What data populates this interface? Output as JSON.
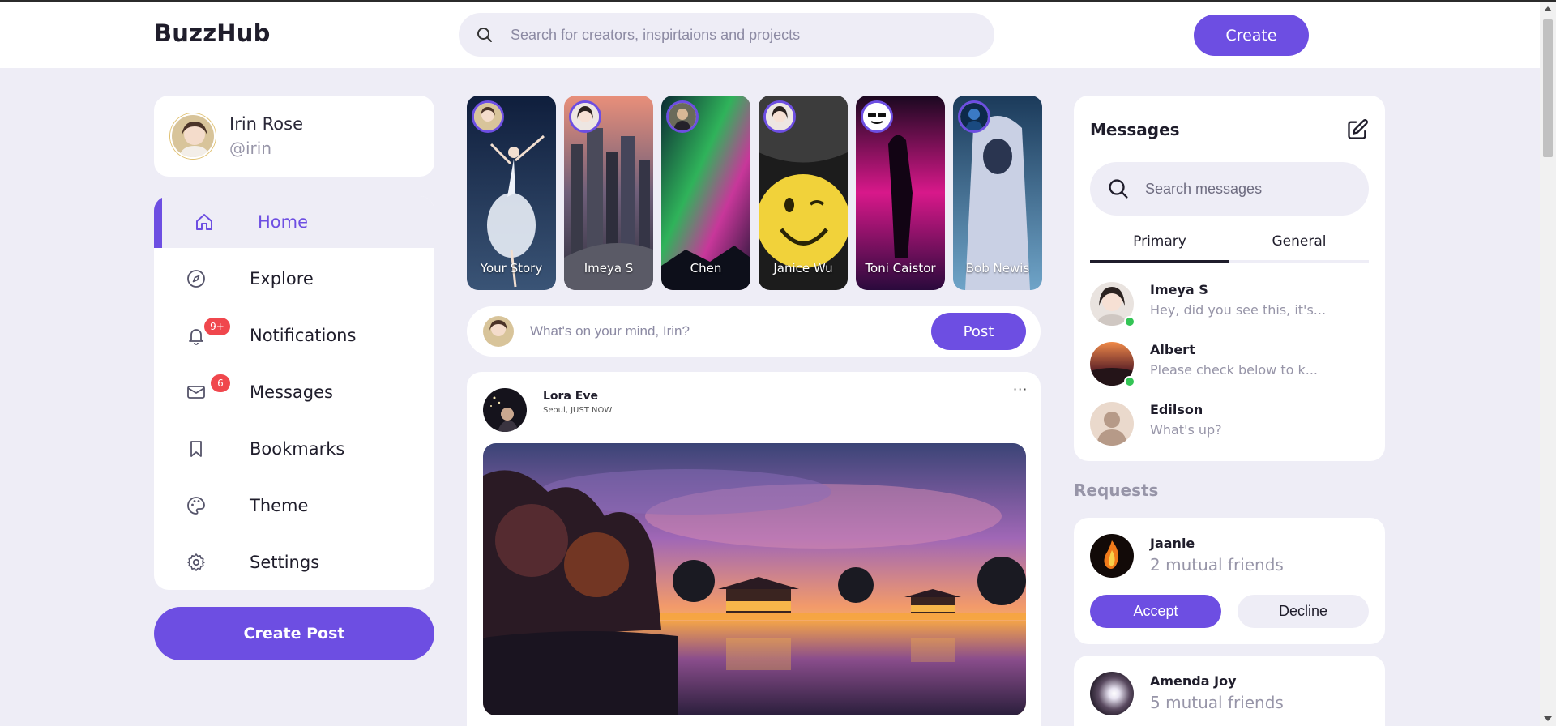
{
  "app": {
    "name": "BuzzHub"
  },
  "header": {
    "search_placeholder": "Search for creators, inspirtaions and projects",
    "create_label": "Create"
  },
  "profile": {
    "name": "Irin Rose",
    "handle": "@irin"
  },
  "sidebar": {
    "items": [
      {
        "label": "Home",
        "icon": "home-icon"
      },
      {
        "label": "Explore",
        "icon": "compass-icon"
      },
      {
        "label": "Notifications",
        "icon": "bell-icon",
        "badge": "9+"
      },
      {
        "label": "Messages",
        "icon": "envelope-icon",
        "badge": "6"
      },
      {
        "label": "Bookmarks",
        "icon": "bookmark-icon"
      },
      {
        "label": "Theme",
        "icon": "palette-icon"
      },
      {
        "label": "Settings",
        "icon": "gear-icon"
      }
    ],
    "create_post_label": "Create Post"
  },
  "stories": [
    {
      "name": "Your Story"
    },
    {
      "name": "Imeya S"
    },
    {
      "name": "Chen"
    },
    {
      "name": "Janice Wu"
    },
    {
      "name": "Toni Caistor"
    },
    {
      "name": "Bob Newis"
    }
  ],
  "composer": {
    "placeholder": "What's on your mind, Irin?",
    "post_label": "Post"
  },
  "feed": {
    "author": "Lora Eve",
    "meta": "Seoul, JUST NOW",
    "more_label": "···"
  },
  "messages": {
    "title": "Messages",
    "search_placeholder": "Search messages",
    "tabs": [
      "Primary",
      "General"
    ],
    "conversations": [
      {
        "name": "Imeya S",
        "preview": "Hey, did you see this, it's...",
        "online": true
      },
      {
        "name": "Albert",
        "preview": "Please check below to k...",
        "online": true
      },
      {
        "name": "Edilson",
        "preview": "What's up?",
        "online": false
      }
    ]
  },
  "requests": {
    "title": "Requests",
    "items": [
      {
        "name": "Jaanie",
        "mutual": "2 mutual friends",
        "accept_label": "Accept",
        "decline_label": "Decline"
      },
      {
        "name": "Amenda Joy",
        "mutual": "5 mutual friends"
      }
    ]
  },
  "colors": {
    "accent": "#6d4ee2",
    "background": "#eeedf6",
    "badge": "#f0474d",
    "online": "#33c455"
  }
}
